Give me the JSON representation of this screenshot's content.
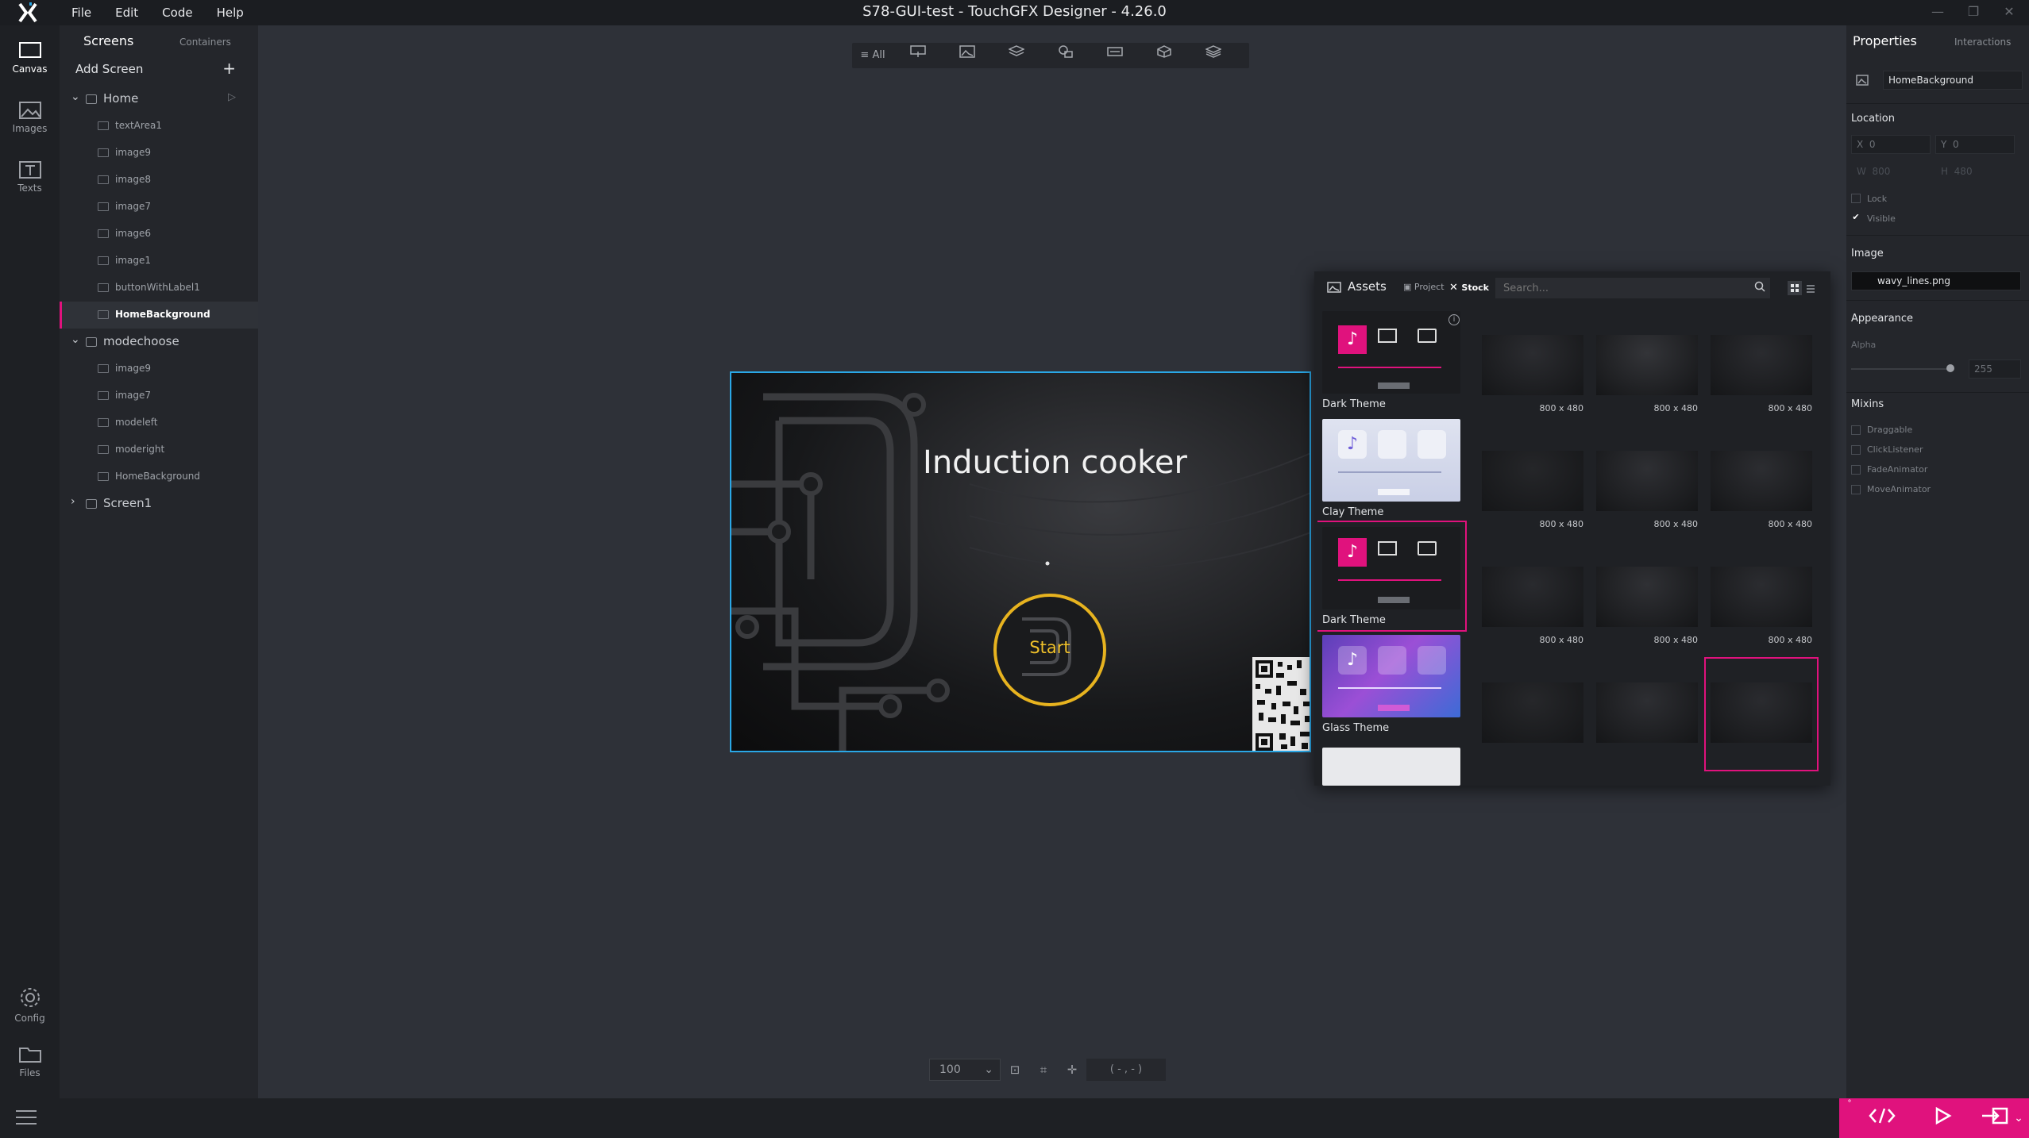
{
  "window": {
    "title": "S78-GUI-test - TouchGFX Designer - 4.26.0",
    "menu": [
      "File",
      "Edit",
      "Code",
      "Help"
    ]
  },
  "rail": {
    "items": [
      {
        "label": "Canvas",
        "icon": "canvas-icon"
      },
      {
        "label": "Images",
        "icon": "image-icon"
      },
      {
        "label": "Texts",
        "icon": "text-icon"
      }
    ],
    "bottom_items": [
      {
        "label": "Config",
        "icon": "gear-icon"
      },
      {
        "label": "Files",
        "icon": "folder-icon"
      }
    ]
  },
  "screens_panel": {
    "tabs": [
      "Screens",
      "Containers"
    ],
    "add_screen_label": "Add Screen",
    "tree": [
      {
        "type": "screen",
        "label": "Home",
        "expanded": true
      },
      {
        "type": "child",
        "label": "textArea1",
        "icon": "textarea-icon"
      },
      {
        "type": "child",
        "label": "image9",
        "icon": "image-icon"
      },
      {
        "type": "child",
        "label": "image8",
        "icon": "image-icon"
      },
      {
        "type": "child",
        "label": "image7",
        "icon": "image-icon"
      },
      {
        "type": "child",
        "label": "image6",
        "icon": "image-icon"
      },
      {
        "type": "child",
        "label": "image1",
        "icon": "image-icon"
      },
      {
        "type": "child",
        "label": "buttonWithLabel1",
        "icon": "button-icon"
      },
      {
        "type": "child",
        "label": "HomeBackground",
        "icon": "image-icon",
        "selected": true
      },
      {
        "type": "screen",
        "label": "modechoose",
        "expanded": true
      },
      {
        "type": "child",
        "label": "image9",
        "icon": "image-icon"
      },
      {
        "type": "child",
        "label": "image7",
        "icon": "image-icon"
      },
      {
        "type": "child",
        "label": "modeleft",
        "icon": "button-icon"
      },
      {
        "type": "child",
        "label": "moderight",
        "icon": "button-icon"
      },
      {
        "type": "child",
        "label": "HomeBackground",
        "icon": "image-icon"
      },
      {
        "type": "screen",
        "label": "Screen1",
        "expanded": false
      }
    ]
  },
  "toolbar": {
    "filter_all": "All"
  },
  "canvas": {
    "screen_title": "Induction cooker",
    "start_label": "Start",
    "zoom": "100",
    "coords": "( - , - )"
  },
  "assets": {
    "title": "Assets",
    "tabs": [
      "Project",
      "Stock"
    ],
    "active_tab": "Stock",
    "search_placeholder": "Search...",
    "themes": [
      {
        "label": "Dark Theme"
      },
      {
        "label": "Clay Theme"
      },
      {
        "label": "Dark Theme",
        "selected": true
      },
      {
        "label": "Glass Theme"
      }
    ],
    "images": [
      {
        "dim": "800 x 480"
      },
      {
        "dim": "800 x 480"
      },
      {
        "dim": "800 x 480"
      },
      {
        "dim": "800 x 480"
      },
      {
        "dim": "800 x 480"
      },
      {
        "dim": "800 x 480"
      },
      {
        "dim": "800 x 480"
      },
      {
        "dim": "800 x 480"
      },
      {
        "dim": "800 x 480"
      },
      {
        "dim": ""
      },
      {
        "dim": ""
      },
      {
        "dim": "",
        "selected": true
      }
    ]
  },
  "properties": {
    "tabs": [
      "Properties",
      "Interactions"
    ],
    "name": "HomeBackground",
    "location_title": "Location",
    "x_label": "X",
    "x_value": "0",
    "y_label": "Y",
    "y_value": "0",
    "w_label": "W",
    "w_value": "800",
    "h_label": "H",
    "h_value": "480",
    "lock_label": "Lock",
    "visible_label": "Visible",
    "image_title": "Image",
    "image_value": "wavy_lines.png",
    "appearance_title": "Appearance",
    "alpha_label": "Alpha",
    "alpha_value": "255",
    "mixins_title": "Mixins",
    "mixins": [
      "Draggable",
      "ClickListener",
      "FadeAnimator",
      "MoveAnimator"
    ]
  },
  "colors": {
    "accent": "#e0127d",
    "selection_blue": "#2aa7e6",
    "start_gold": "#e7b31f"
  }
}
